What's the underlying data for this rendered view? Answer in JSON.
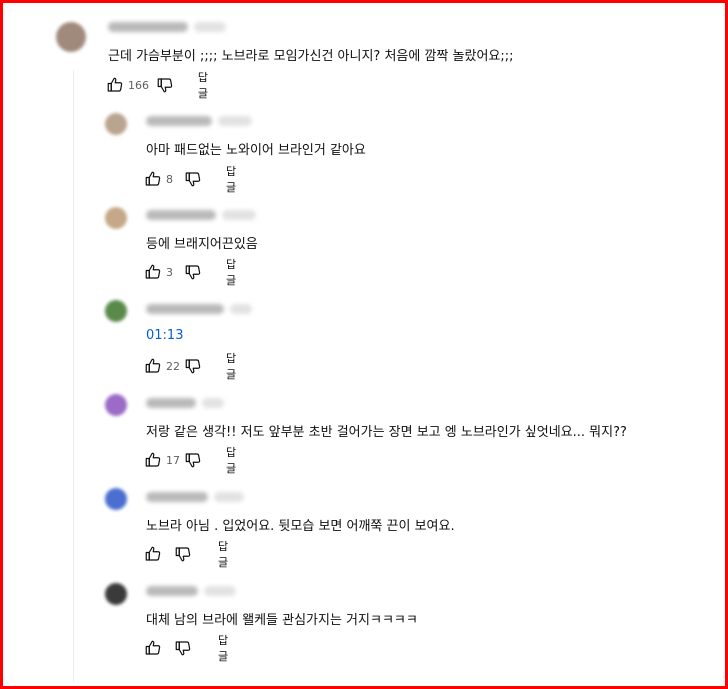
{
  "comments": [
    {
      "text": "근데 가슴부분이 ;;;; 노브라로 모임가신건 아니지? 처음에 깜짝 놀랐어요;;;",
      "likes": "166",
      "reply_label": "답글",
      "avatar_color": "#a08a7b"
    },
    {
      "text": "아마 패드없는 노와이어 브라인거 같아요",
      "likes": "8",
      "reply_label": "답글",
      "avatar_color": "#b9a58f"
    },
    {
      "text": "등에 브래지어끈있음",
      "likes": "3",
      "reply_label": "답글",
      "avatar_color": "#c4a888"
    },
    {
      "text": "01:13",
      "likes": "22",
      "reply_label": "답글",
      "avatar_color": "#5a8a4a",
      "is_timestamp": true
    },
    {
      "text": "저랑 같은 생각!! 저도 앞부분 초반 걸어가는 장면 보고 엥 노브라인가 싶엇네요... 뭐지??",
      "likes": "17",
      "reply_label": "답글",
      "avatar_color": "#9b6bc7"
    },
    {
      "text": "노브라 아님 . 입었어요. 뒷모습 보면 어깨쭉 끈이 보여요.",
      "likes": "",
      "reply_label": "답글",
      "avatar_color": "#4a6fd0"
    },
    {
      "text": "대체 남의 브라에 왤케들 관심가지는 거지ㅋㅋㅋㅋ",
      "likes": "",
      "reply_label": "답글",
      "avatar_color": "#3a3a3a"
    }
  ],
  "icons": {
    "like": "thumbs-up-icon",
    "dislike": "thumbs-down-icon"
  },
  "colors": {
    "border": "#ff0000",
    "link": "#065fd4"
  }
}
